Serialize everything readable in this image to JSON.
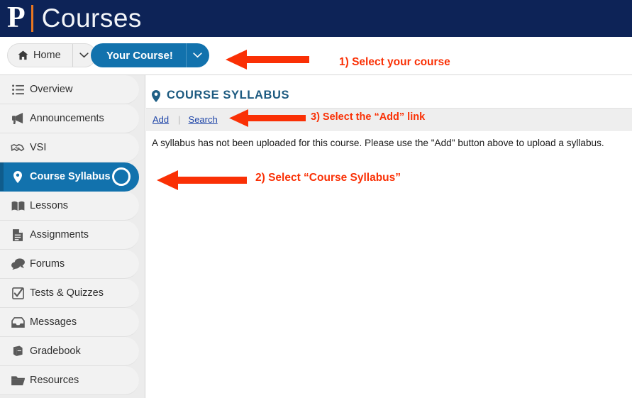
{
  "masthead": {
    "logo_letter": "P",
    "logo_word": "Courses",
    "accent_color": "#e87722",
    "background_color": "#0d2357"
  },
  "navbar": {
    "home_button": {
      "label": "Home",
      "icon": "home-icon",
      "caret": "chevron-down-icon"
    },
    "course_button": {
      "label": "Your Course!",
      "icon": "chevron-down-icon",
      "background_color": "#1272ad"
    }
  },
  "sidebar": {
    "items": [
      {
        "label": "Overview",
        "icon": "list-icon",
        "active": false
      },
      {
        "label": "Announcements",
        "icon": "megaphone-icon",
        "active": false
      },
      {
        "label": "VSI",
        "icon": "handshake-icon",
        "active": false
      },
      {
        "label": "Course Syllabus",
        "icon": "map-pin-icon",
        "active": true
      },
      {
        "label": "Lessons",
        "icon": "open-book-icon",
        "active": false
      },
      {
        "label": "Assignments",
        "icon": "document-icon",
        "active": false
      },
      {
        "label": "Forums",
        "icon": "chat-bubbles-icon",
        "active": false
      },
      {
        "label": "Tests & Quizzes",
        "icon": "checkbox-icon",
        "active": false
      },
      {
        "label": "Messages",
        "icon": "inbox-icon",
        "active": false
      },
      {
        "label": "Gradebook",
        "icon": "gradebook-icon",
        "active": false
      },
      {
        "label": "Resources",
        "icon": "folder-icon",
        "active": false
      }
    ],
    "active_color": "#1272ad"
  },
  "main": {
    "title": "COURSE SYLLABUS",
    "title_icon": "map-pin-icon",
    "toolbar": {
      "add_label": "Add",
      "separator": "|",
      "search_label": "Search"
    },
    "body_text": "A syllabus has not been uploaded for this course. Please use the \"Add\" button above to upload a syllabus."
  },
  "annotations": {
    "color": "#fa3005",
    "step1": "1) Select your course",
    "step2": "2) Select “Course Syllabus”",
    "step3": "3) Select the “Add” link"
  }
}
